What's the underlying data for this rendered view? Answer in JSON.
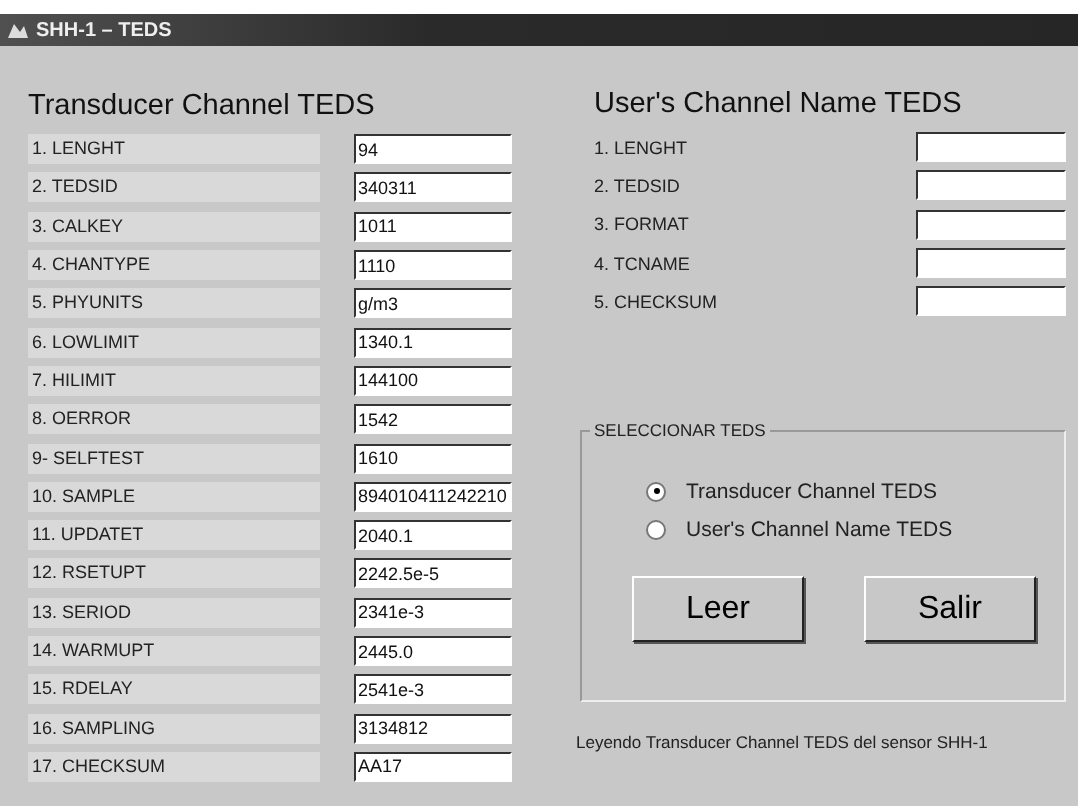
{
  "window": {
    "title": "SHH-1 – TEDS"
  },
  "transducer_teds": {
    "title": "Transducer Channel TEDS",
    "fields": [
      {
        "label": "1. LENGHT",
        "value": "94"
      },
      {
        "label": "2. TEDSID",
        "value": "340311"
      },
      {
        "label": "3. CALKEY",
        "value": "1011"
      },
      {
        "label": "4. CHANTYPE",
        "value": "1110"
      },
      {
        "label": "5. PHYUNITS",
        "value": "g/m3"
      },
      {
        "label": "6. LOWLIMIT",
        "value": "1340.1"
      },
      {
        "label": "7. HILIMIT",
        "value": "144100"
      },
      {
        "label": "8. OERROR",
        "value": "1542"
      },
      {
        "label": "9- SELFTEST",
        "value": "1610"
      },
      {
        "label": "10. SAMPLE",
        "value": "894010411242210"
      },
      {
        "label": "11. UPDATET",
        "value": "2040.1"
      },
      {
        "label": "12. RSETUPT",
        "value": "2242.5e-5"
      },
      {
        "label": "13. SERIOD",
        "value": "2341e-3"
      },
      {
        "label": "14. WARMUPT",
        "value": "2445.0"
      },
      {
        "label": "15. RDELAY",
        "value": "2541e-3"
      },
      {
        "label": "16. SAMPLING",
        "value": "3134812"
      },
      {
        "label": "17. CHECKSUM",
        "value": "AA17"
      }
    ]
  },
  "user_teds": {
    "title": "User's Channel Name TEDS",
    "fields": [
      {
        "label": "1. LENGHT"
      },
      {
        "label": "2. TEDSID"
      },
      {
        "label": "3. FORMAT"
      },
      {
        "label": "4. TCNAME"
      },
      {
        "label": "5. CHECKSUM"
      }
    ]
  },
  "select_group": {
    "title": "SELECCIONAR TEDS",
    "options": [
      {
        "label": "Transducer Channel TEDS",
        "selected": true
      },
      {
        "label": "User's Channel Name TEDS",
        "selected": false
      }
    ],
    "buttons": [
      "Leer",
      "Salir"
    ]
  },
  "status": "Leyendo Transducer Channel TEDS del sensor SHH-1"
}
